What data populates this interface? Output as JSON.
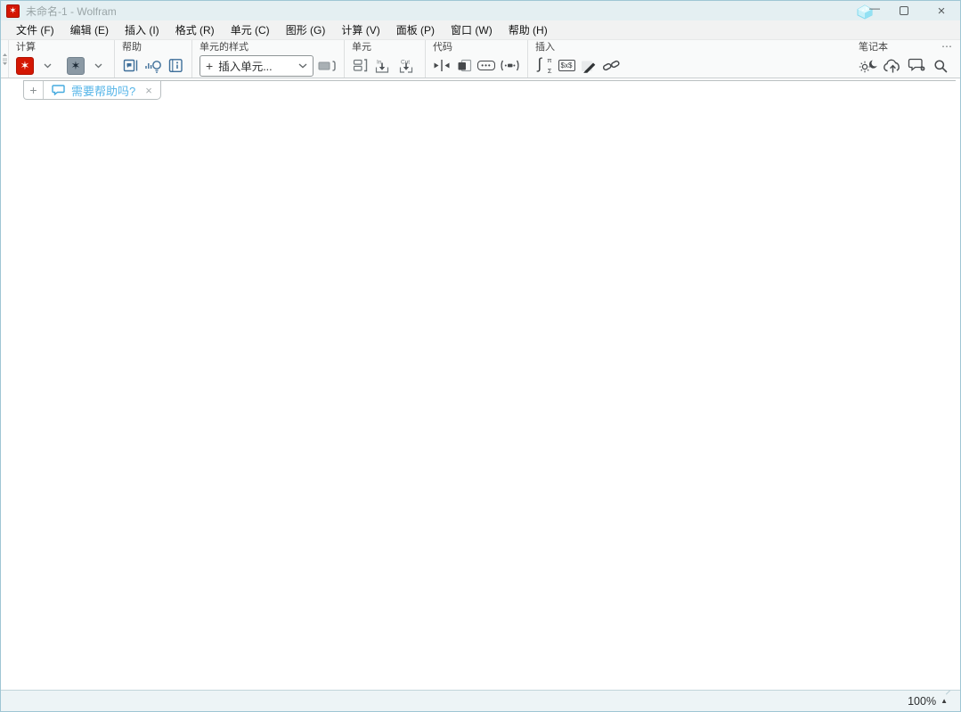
{
  "colors": {
    "wolfram_red": "#d41703",
    "steel_blue": "#3d6e99",
    "tab_blue": "#55b5e8",
    "titlebar_bg": "#e4eff2"
  },
  "window": {
    "title": "未命名-1 - Wolfram",
    "app_icon": "wolfram-spikey-icon",
    "app_icon_glyph": "✶",
    "controls": {
      "sparkle_icon": "wolfram-assistant-sparkle",
      "minimize_glyph": "—",
      "maximize_icon": "maximize-square",
      "close_glyph": "×"
    }
  },
  "menu": {
    "items": [
      "文件 (F)",
      "编辑 (E)",
      "插入 (I)",
      "格式 (R)",
      "单元 (C)",
      "图形 (G)",
      "计算 (V)",
      "面板 (P)",
      "窗口 (W)",
      "帮助 (H)"
    ]
  },
  "toolbar": {
    "overflow_glyph": "⋯",
    "groups": [
      {
        "label": "计算",
        "items": [
          {
            "name": "evaluate-button",
            "icon": "wolfram-spikey-red",
            "glyph": "✶"
          },
          {
            "name": "evaluate-menu-chevron",
            "icon": "chevron-down"
          },
          {
            "name": "dynamic-button",
            "icon": "wolfram-spikey-gray",
            "glyph": "✶"
          },
          {
            "name": "dynamic-menu-chevron",
            "icon": "chevron-down"
          }
        ]
      },
      {
        "label": "帮助",
        "items": [
          {
            "name": "documentation-button",
            "icon": "doc-chat-square"
          },
          {
            "name": "tips-button",
            "icon": "lightbulb-bars"
          },
          {
            "name": "reference-book-button",
            "icon": "book-info"
          }
        ]
      },
      {
        "label": "单元的样式",
        "dropdown": {
          "name": "insert-cell-dropdown",
          "prefix": "+",
          "value": "插入单元...",
          "chevron": "chevron-down"
        },
        "items": [
          {
            "name": "cell-appearance-button",
            "icon": "cell-rect-bracket"
          }
        ]
      },
      {
        "label": "单元",
        "items": [
          {
            "name": "group-cells-button",
            "icon": "cells-bracket"
          },
          {
            "name": "merge-cells-button",
            "icon": "arrow-into-cell",
            "text": "In"
          },
          {
            "name": "divide-cell-button",
            "icon": "arrow-cut-cell",
            "text": "Cut"
          }
        ]
      },
      {
        "label": "代码",
        "items": [
          {
            "name": "extend-selection-button",
            "icon": "carets-bar"
          },
          {
            "name": "format-code-button",
            "icon": "framed-square"
          },
          {
            "name": "comment-button",
            "icon": "dots-pill",
            "text": "•••"
          },
          {
            "name": "iconize-button",
            "icon": "iconize-parens"
          }
        ]
      },
      {
        "label": "插入",
        "items": [
          {
            "name": "math-template-button",
            "icon": "integral-template",
            "glyph_main": "∫",
            "glyph_sup": "π",
            "glyph_sub": "Σ"
          },
          {
            "name": "inline-tex-button",
            "icon": "tex-box",
            "text": "$x$"
          },
          {
            "name": "freeform-input-button",
            "icon": "pen-marker"
          },
          {
            "name": "hyperlink-button",
            "icon": "link-chain"
          }
        ]
      },
      {
        "label": "笔记本",
        "items": [
          {
            "name": "theme-toggle-button",
            "icon": "sun-moon"
          },
          {
            "name": "cloud-publish-button",
            "icon": "cloud-upload"
          },
          {
            "name": "feedback-button",
            "icon": "chat-gear"
          },
          {
            "name": "search-button",
            "icon": "magnifier"
          }
        ]
      }
    ]
  },
  "tabbar": {
    "new_tab_label": "+",
    "help_tab": {
      "icon": "chat-bubble-icon",
      "label": "需要帮助吗?",
      "close_glyph": "×"
    }
  },
  "statusbar": {
    "zoom_label": "100%",
    "zoom_indicator": "▲"
  }
}
